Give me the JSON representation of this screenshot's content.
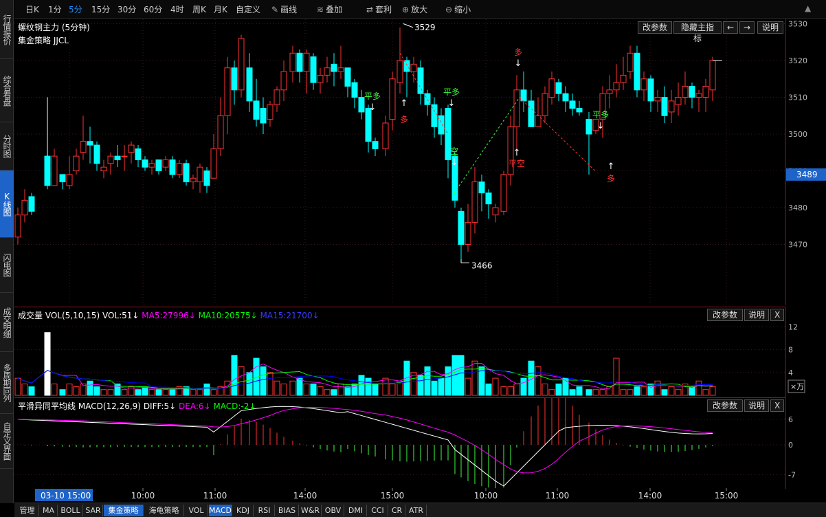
{
  "side_tabs": [
    {
      "label": "行情报价",
      "active": false
    },
    {
      "label": "综合看盘",
      "active": false
    },
    {
      "label": "分时图",
      "active": false
    },
    {
      "label": "K线图",
      "active": true
    },
    {
      "label": "闪电图",
      "active": false
    },
    {
      "label": "成交明细",
      "active": false
    },
    {
      "label": "多周期同列",
      "active": false
    },
    {
      "label": "自定义界面",
      "active": false
    }
  ],
  "toolbar": {
    "periods": [
      "日K",
      "1分",
      "5分",
      "15分",
      "30分",
      "60分",
      "4时",
      "周K",
      "月K",
      "自定义"
    ],
    "active_period": "5分",
    "draw": "画线",
    "overlay": "叠加",
    "arbitrage": "套利",
    "zoom_in": "放大",
    "zoom_out": "缩小"
  },
  "main": {
    "title": "螺纹钢主力 (5分钟)",
    "strategy": "集金策略 JJCL",
    "buttons": [
      "改参数",
      "隐藏主指标",
      "←",
      "→",
      "说明"
    ],
    "current_price": "3489",
    "price_ticks": [
      "3530",
      "3520",
      "3510",
      "3500",
      "3490",
      "3480",
      "3470"
    ],
    "annotations": {
      "high": "3529",
      "low": "3466",
      "ping_duo": "平多",
      "duo": "多",
      "kong": "空",
      "ping_kong": "平空"
    }
  },
  "volume": {
    "label": "成交量",
    "params": "VOL(5,10,15)",
    "vol": "VOL:51↓",
    "ma5": "MA5:27996↓",
    "ma10": "MA10:20575↓",
    "ma15": "MA15:21700↓",
    "ticks": [
      "12",
      "8",
      "4"
    ],
    "unit": "×万",
    "buttons": [
      "改参数",
      "说明",
      "X"
    ]
  },
  "macd": {
    "label": "平滑异同平均线",
    "params": "MACD(12,26,9)",
    "diff": "DIFF:5↓",
    "dea": "DEA:6↓",
    "macd": "MACD:-2↓",
    "ticks": [
      "6",
      "0",
      "-7"
    ],
    "buttons": [
      "改参数",
      "说明",
      "X"
    ]
  },
  "time_axis": {
    "highlight": "03-10 15:00",
    "labels": [
      "10:00",
      "11:00",
      "14:00",
      "15:00",
      "10:00",
      "11:00",
      "14:00",
      "15:00"
    ]
  },
  "bottom_tabs": [
    "管理",
    "MA",
    "BOLL",
    "SAR",
    "集金策略",
    "海龟策略",
    "VOL",
    "MACD",
    "KDJ",
    "RSI",
    "BIAS",
    "W&R",
    "OBV",
    "DMI",
    "CCI",
    "CR",
    "ATR"
  ],
  "bottom_active": [
    "集金策略",
    "MACD"
  ],
  "colors": {
    "up": "#ff3232",
    "down": "#00ffff",
    "grid": "#3a1a1a",
    "ma5": "#ff00ff",
    "ma10": "#00ff00",
    "ma15": "#0000ff",
    "dea": "#ff00ff",
    "highlight": "#1e64c8"
  }
}
